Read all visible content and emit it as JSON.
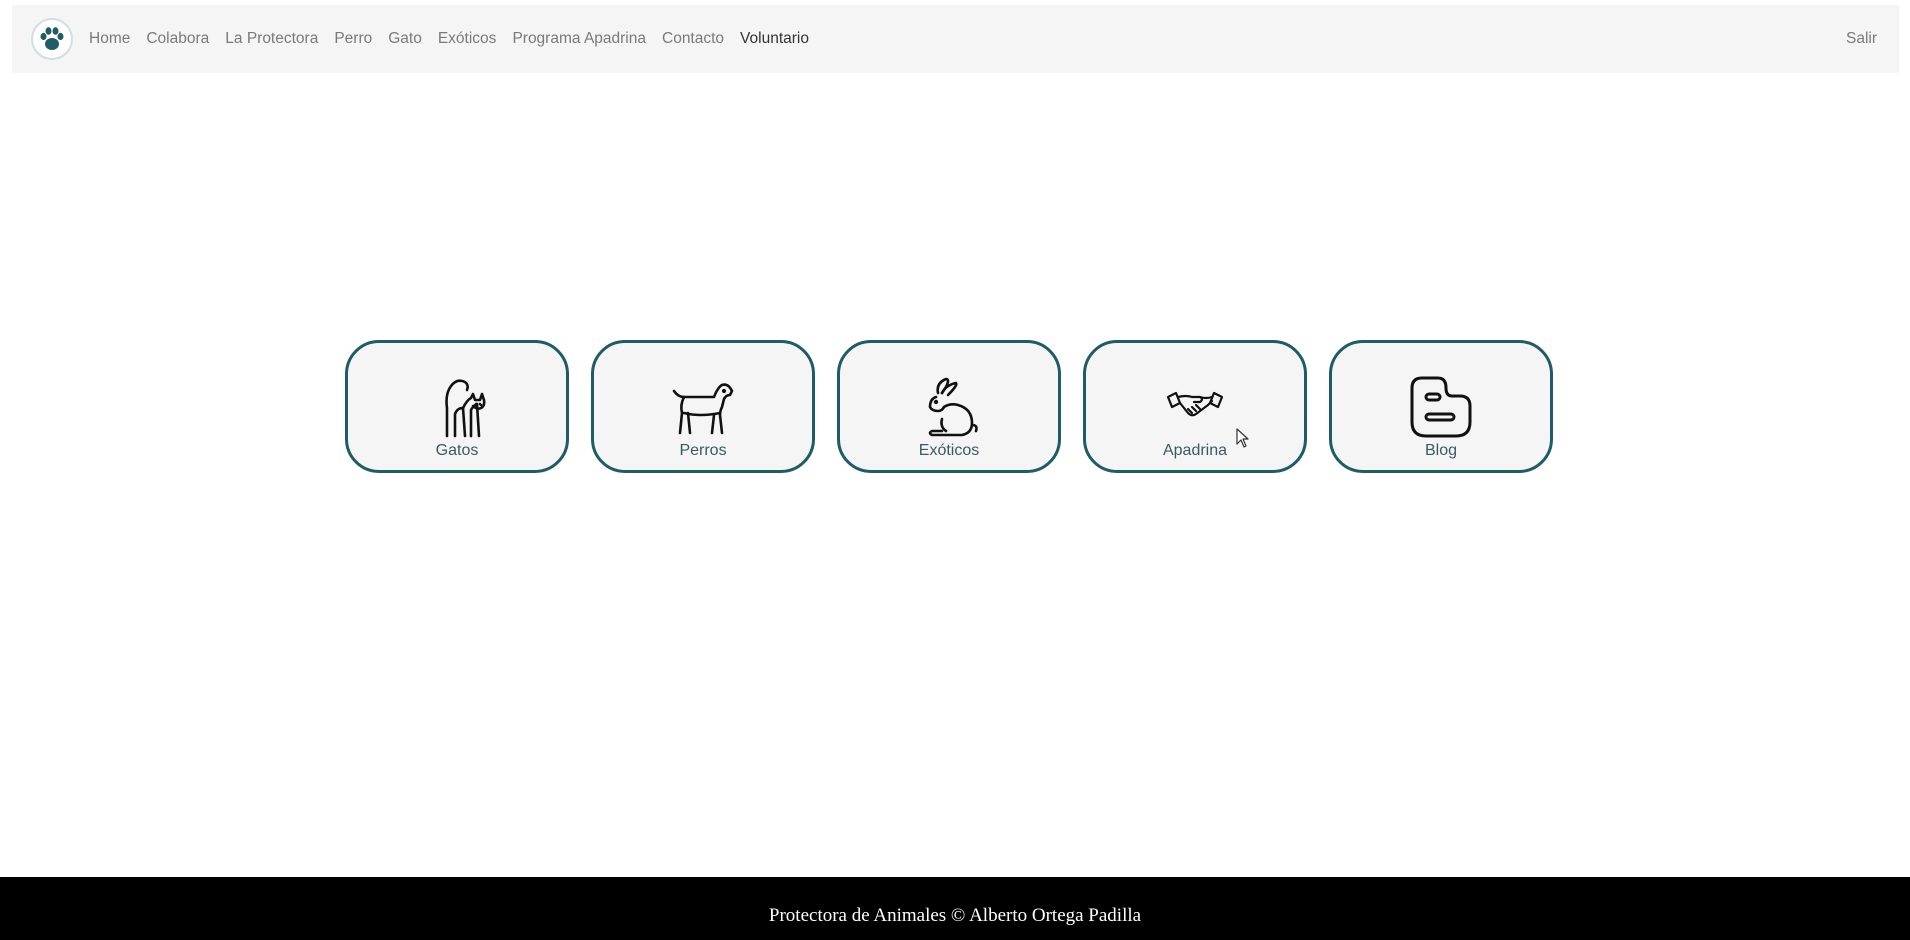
{
  "nav": {
    "logo_icon": "paw-print-icon",
    "links": [
      {
        "label": "Home"
      },
      {
        "label": "Colabora"
      },
      {
        "label": "La Protectora"
      },
      {
        "label": "Perro"
      },
      {
        "label": "Gato"
      },
      {
        "label": "Exóticos"
      },
      {
        "label": "Programa Apadrina"
      },
      {
        "label": "Contacto"
      },
      {
        "label": "Voluntario",
        "active": true
      }
    ],
    "logout_label": "Salir"
  },
  "cards": [
    {
      "label": "Gatos",
      "icon": "cat-icon"
    },
    {
      "label": "Perros",
      "icon": "dog-icon"
    },
    {
      "label": "Exóticos",
      "icon": "rabbit-icon"
    },
    {
      "label": "Apadrina",
      "icon": "handshake-icon"
    },
    {
      "label": "Blog",
      "icon": "blogger-icon"
    }
  ],
  "footer": {
    "text": "Protectora de Animales © Alberto Ortega Padilla"
  },
  "colors": {
    "accent": "#1f5c66",
    "navbar_bg": "#f5f5f5",
    "footer_bg": "#000000"
  }
}
